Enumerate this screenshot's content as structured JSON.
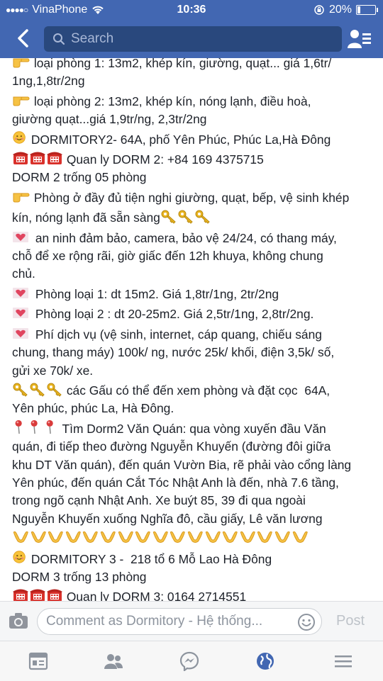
{
  "status": {
    "carrier": "VinaPhone",
    "time": "10:36",
    "battery": "20%",
    "battery_level": 0.2
  },
  "nav": {
    "search_placeholder": "Search"
  },
  "post": {
    "lines": [
      {
        "emoji": "point",
        "text": "loại phòng 1: 13m2, khép kín, giường, quạt... giá 1,6tr/"
      },
      {
        "emoji": "",
        "text": "1ng,1,8tr/2ng"
      },
      {
        "emoji": "point",
        "text": "loại phòng 2: 13m2, khép kín, nóng lạnh, điều hoà,"
      },
      {
        "emoji": "",
        "text": "giường quạt...giá 1,9tr/ng, 2,3tr/2ng"
      },
      {
        "emoji": "smile",
        "text": "DORMITORY2- 64A, phố Yên Phúc, Phúc La,Hà Đông"
      },
      {
        "emoji": "phone3",
        "text": "Quan ly DORM 2: +84 169 4375715"
      },
      {
        "emoji": "",
        "text": "DORM 2 trống 05 phòng"
      },
      {
        "emoji": "point",
        "text": "Phòng ở đầy đủ tiện nghi giường, quạt, bếp, vệ sinh khép"
      },
      {
        "emoji": "",
        "text": "kín, nóng lạnh đã sẵn sàng",
        "trail": "key3"
      },
      {
        "emoji": "heart",
        "text": "an ninh đảm bảo, camera, bảo vệ 24/24, có thang máy,"
      },
      {
        "emoji": "",
        "text": "chỗ để xe rộng rãi, giờ giấc đến 12h khuya, không chung"
      },
      {
        "emoji": "",
        "text": "chủ."
      },
      {
        "emoji": "heart",
        "text": "Phòng loại 1: dt 15m2. Giá 1,8tr/1ng, 2tr/2ng"
      },
      {
        "emoji": "heart",
        "text": "Phòng loại 2 : dt 20-25m2. Giá 2,5tr/1ng, 2,8tr/2ng."
      },
      {
        "emoji": "heart",
        "text": "Phí dịch vụ (vệ sinh, internet, cáp quang, chiếu sáng"
      },
      {
        "emoji": "",
        "text": "chung, thang máy) 100k/ ng, nước 25k/ khối, điện 3,5k/ số,"
      },
      {
        "emoji": "",
        "text": "gửi xe 70k/ xe."
      },
      {
        "emoji": "key3",
        "text": "các Gấu có thể đến xem phòng và đặt cọc  64A,"
      },
      {
        "emoji": "",
        "text": "Yên phúc, phúc La, Hà Đông."
      },
      {
        "emoji": "pin3",
        "text": "Tìm Dorm2 Văn Quán: qua vòng xuyến đầu Văn"
      },
      {
        "emoji": "",
        "text": "quán, đi tiếp theo đường Nguyễn Khuyến (đường đôi giữa"
      },
      {
        "emoji": "",
        "text": "khu DT Văn quán), đến quán Vườn Bia, rẽ phải vào cổng làng"
      },
      {
        "emoji": "",
        "text": "Yên phúc, đến quán Cắt Tóc Nhật Anh là đến, nhà 7.6 tầng,"
      },
      {
        "emoji": "",
        "text": "trong ngõ cạnh Nhật Anh. Xe buýt 85, 39 đi qua ngoài"
      },
      {
        "emoji": "",
        "text": "Nguyễn Khuyến xuống Nghĩa đô, cầu giấy, Lê văn lương"
      },
      {
        "emoji": "hands17",
        "text": ""
      },
      {
        "emoji": "smile",
        "text": "DORMITORY 3 -  218 tổ 6 Mỗ Lao Hà Đông"
      },
      {
        "emoji": "",
        "text": "DORM 3 trống 13 phòng"
      },
      {
        "emoji": "phone3",
        "text": "Quan ly DORM 3: 0164 2714551"
      }
    ]
  },
  "composer": {
    "placeholder": "Comment as Dormitory - Hệ thống...",
    "post_label": "Post"
  },
  "tabs": [
    "news-feed-icon",
    "friends-icon",
    "messenger-icon",
    "globe-icon",
    "menu-icon"
  ],
  "colors": {
    "brand": "#4267b2",
    "active_tab": "#4267b2",
    "inactive_tab": "#8d949e"
  }
}
